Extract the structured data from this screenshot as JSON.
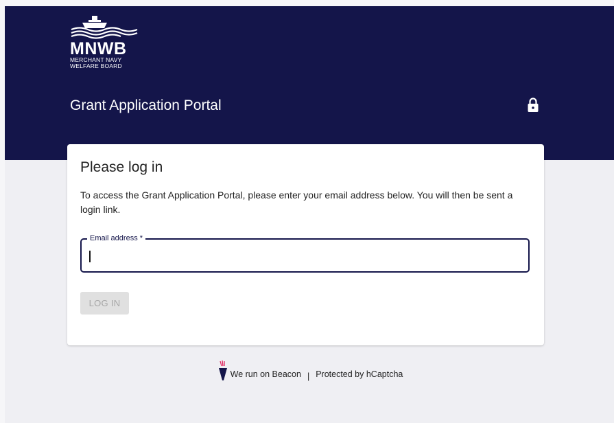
{
  "header": {
    "logo": {
      "mark": "MNWB",
      "line1": "MERCHANT NAVY",
      "line2": "WELFARE BOARD",
      "icon": "ship-icon"
    },
    "portal_title": "Grant Application Portal",
    "lock_icon": "lock-icon",
    "background_color": "#14154a"
  },
  "card": {
    "title": "Please log in",
    "description": "To access the Grant Application Portal, please enter your email address below. You will then be sent a login link.",
    "email": {
      "label": "Email address *",
      "value": "",
      "placeholder": ""
    },
    "login_button": "LOG IN"
  },
  "footer": {
    "beacon_text": "We run on Beacon",
    "separator": "|",
    "captcha_text": "Protected by hCaptcha",
    "icon": "beacon-torch-icon"
  }
}
